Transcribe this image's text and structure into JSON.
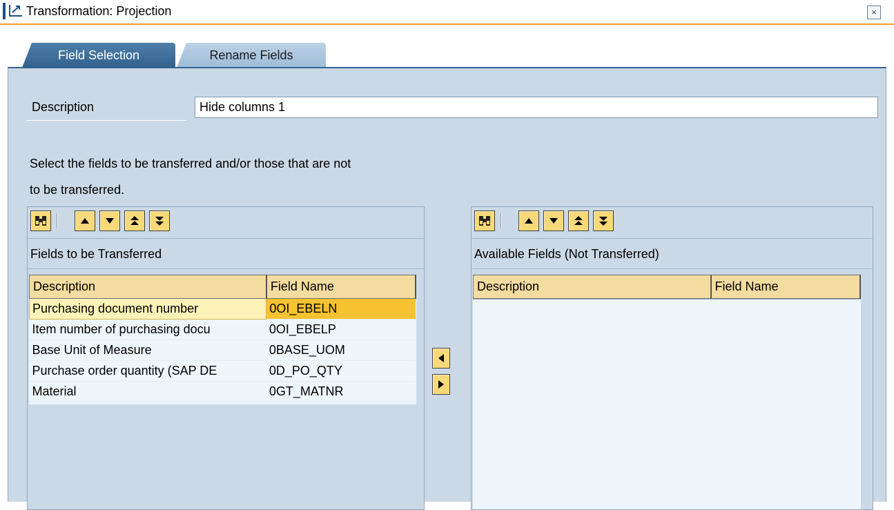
{
  "window": {
    "title": "Transformation: Projection",
    "close_label": "×"
  },
  "tabs": [
    {
      "label": "Field Selection",
      "active": true
    },
    {
      "label": "Rename Fields",
      "active": false
    }
  ],
  "description": {
    "label": "Description",
    "value": "Hide columns 1"
  },
  "instructions": {
    "line1": "Select the fields to be transferred and/or those that are not",
    "line2": "to be transferred."
  },
  "toolbar_icons": [
    "binoculars-icon",
    "move-up-icon",
    "move-down-icon",
    "move-to-top-icon",
    "move-to-bottom-icon"
  ],
  "transferred": {
    "title": "Fields to be Transferred",
    "columns": [
      "Description",
      "Field Name"
    ],
    "rows": [
      {
        "description": "Purchasing document number",
        "field": "0OI_EBELN",
        "selected": true
      },
      {
        "description": "Item number of purchasing docu",
        "field": "0OI_EBELP",
        "selected": false
      },
      {
        "description": "Base Unit of Measure",
        "field": "0BASE_UOM",
        "selected": false
      },
      {
        "description": "Purchase order quantity (SAP DE",
        "field": "0D_PO_QTY",
        "selected": false
      },
      {
        "description": "Material",
        "field": "0GT_MATNR",
        "selected": false
      }
    ]
  },
  "available": {
    "title": "Available Fields (Not Transferred)",
    "columns": [
      "Description",
      "Field Name"
    ],
    "rows": []
  },
  "move_buttons": [
    "move-left-icon",
    "move-right-icon"
  ],
  "colors": {
    "tab_active": "#31628e",
    "panel_bg": "#cbd9e6",
    "header_bg": "#f3dca0",
    "selection": "#f7c230",
    "button_bg": "#f7d97a",
    "title_underline": "#f0a030"
  }
}
